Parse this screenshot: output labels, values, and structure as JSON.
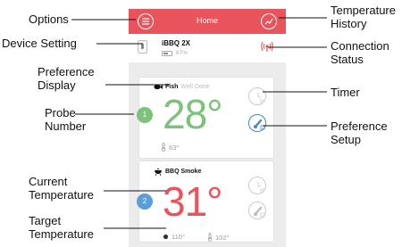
{
  "header": {
    "title": "Home"
  },
  "device": {
    "name": "iBBQ 2X",
    "battery_text": "67%",
    "battery_level": 0.67
  },
  "cards": [
    {
      "probe_number": "1",
      "pref_name": "Fish",
      "pref_doneness": "Well Done",
      "current_temp": "28°",
      "second_temp": "63°"
    },
    {
      "probe_number": "2",
      "pref_name": "BBQ Smoke",
      "current_temp": "31°",
      "target_temp": "110°",
      "second_temp": "102°"
    }
  ],
  "annotations": {
    "options": "Options",
    "temp_history": [
      "Temperature",
      "History"
    ],
    "device_setting": "Device Setting",
    "connection_status": [
      "Connection",
      "Status"
    ],
    "pref_display": [
      "Preference",
      "Display"
    ],
    "timer": "Timer",
    "probe_number": [
      "Probe",
      "Number"
    ],
    "pref_setup": [
      "Preference",
      "Setup"
    ],
    "current_temp": [
      "Current",
      "Temperature"
    ],
    "target_temp": [
      "Target",
      "Temperature"
    ]
  },
  "colors": {
    "header": "#e9535b",
    "probe1": "#7cc27a",
    "probe2": "#5b9fd8",
    "temp2": "#e9535b",
    "pref_button": "#4a86c7"
  },
  "icons": {
    "options": "menu-icon",
    "history": "chart-icon",
    "device": "device-icon",
    "connection": "signal-icon",
    "timer": "timer-icon",
    "preference": "thermometer-icon",
    "fish": "fish-icon",
    "bbq": "grill-icon"
  }
}
